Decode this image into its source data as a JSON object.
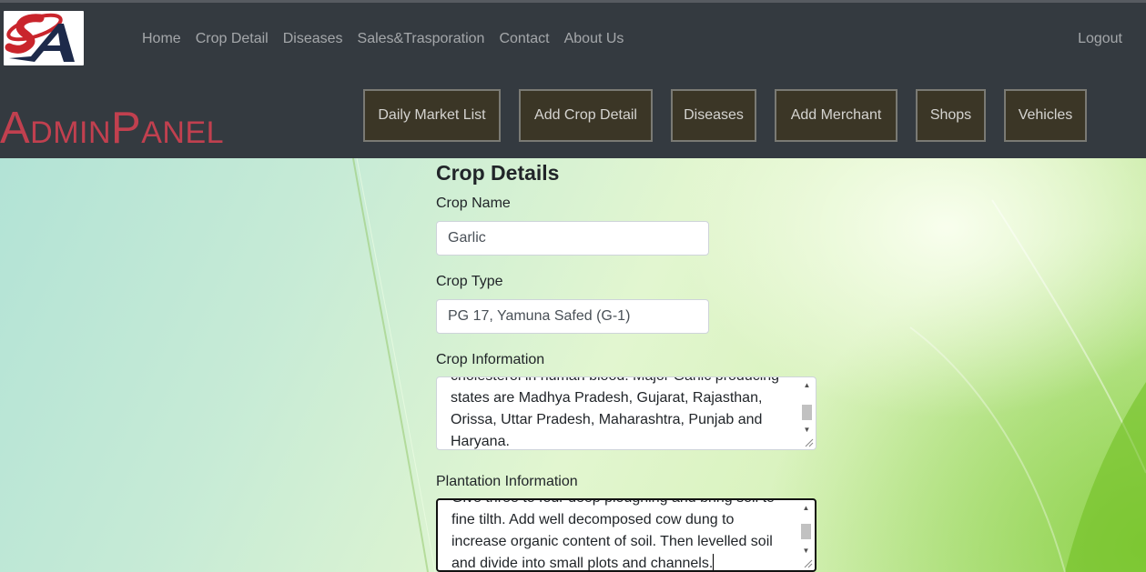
{
  "nav": {
    "logo_text": "SA",
    "links": [
      "Home",
      "Crop Detail",
      "Diseases",
      "Sales&Trasporation",
      "Contact",
      "About Us"
    ],
    "logout": "Logout",
    "brand": "AdminPanel"
  },
  "admin_buttons": [
    "Daily Market List",
    "Add Crop Detail",
    "Diseases",
    "Add Merchant",
    "Shops",
    "Vehicles"
  ],
  "form": {
    "title": "Crop Details",
    "crop_name_label": "Crop Name",
    "crop_name_value": "Garlic",
    "crop_type_label": "Crop Type",
    "crop_type_value": "PG 17, Yamuna Safed (G-1)",
    "crop_info_label": "Crop Information",
    "crop_info_text": "cholesterol in human blood. Major Garlic producing\nstates are Madhya Pradesh, Gujarat, Rajasthan,\nOrissa, Uttar Pradesh, Maharashtra, Punjab and\nHaryana.",
    "plantation_label": "Plantation Information",
    "plantation_text": "Give three to four deep ploughing and bring soil to\nfine tilth. Add well decomposed cow dung to\nincrease organic content of soil. Then levelled soil\nand divide into small plots and channels."
  },
  "colors": {
    "navbar": "#343a40",
    "brand": "#c1404f",
    "admin_button_bg": "#3b3626"
  }
}
